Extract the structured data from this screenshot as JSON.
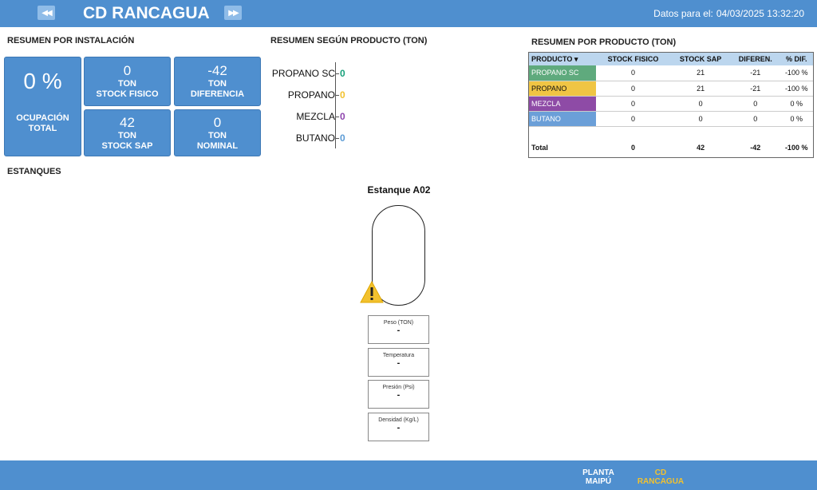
{
  "header": {
    "prev_icon": "◀◀",
    "next_icon": "▶▶",
    "title": "CD RANCAGUA",
    "timestamp_label": "Datos para el:",
    "timestamp_value": "04/03/2025 13:32:20"
  },
  "install_summary": {
    "title": "RESUMEN POR INSTALACIÓN",
    "occupancy": {
      "value": "0 %",
      "label": "OCUPACIÓN TOTAL"
    },
    "stock_fisico": {
      "value": "0",
      "unit": "TON",
      "label": "STOCK FISICO"
    },
    "diferencia": {
      "value": "-42",
      "unit": "TON",
      "label": "DIFERENCIA"
    },
    "stock_sap": {
      "value": "42",
      "unit": "TON",
      "label": "STOCK SAP"
    },
    "nominal": {
      "value": "0",
      "unit": "TON",
      "label": "NOMINAL"
    }
  },
  "product_summary": {
    "title": "RESUMEN SEGÚN PRODUCTO (TON)",
    "items": [
      {
        "name": "PROPANO SC",
        "value": "0",
        "color": "#17a07a"
      },
      {
        "name": "PROPANO",
        "value": "0",
        "color": "#f2c12e"
      },
      {
        "name": "MEZCLA",
        "value": "0",
        "color": "#8e44ad"
      },
      {
        "name": "BUTANO",
        "value": "0",
        "color": "#5b9bd5"
      }
    ]
  },
  "product_table": {
    "title": "RESUMEN POR PRODUCTO (TON)",
    "headers": [
      "PRODUCTO",
      "STOCK FISICO",
      "STOCK SAP",
      "DIFEREN.",
      "% DIF."
    ],
    "sort_icon": "▾",
    "rows": [
      {
        "product": "PROPANO SC",
        "color": "#5faa7d",
        "text_color": "#ffffff",
        "fisico": "0",
        "sap": "21",
        "dif": "-21",
        "pct": "-100 %"
      },
      {
        "product": "PROPANO",
        "color": "#f0c544",
        "text_color": "#111111",
        "fisico": "0",
        "sap": "21",
        "dif": "-21",
        "pct": "-100 %"
      },
      {
        "product": "MEZCLA",
        "color": "#8e4ba6",
        "text_color": "#ffffff",
        "fisico": "0",
        "sap": "0",
        "dif": "0",
        "pct": "0 %"
      },
      {
        "product": "BUTANO",
        "color": "#6b9fd8",
        "text_color": "#ffffff",
        "fisico": "0",
        "sap": "0",
        "dif": "0",
        "pct": "0 %"
      }
    ],
    "total": {
      "label": "Total",
      "fisico": "0",
      "sap": "42",
      "dif": "-42",
      "pct": "-100 %"
    }
  },
  "tanks": {
    "title": "ESTANQUES",
    "tank_name": "Estanque A02",
    "warning_icon": "warning-triangle-icon",
    "metrics": [
      {
        "label": "Peso (TON)",
        "value": "-"
      },
      {
        "label": "Temperatura",
        "value": "-"
      },
      {
        "label": "Presión (Psi)",
        "value": "-"
      },
      {
        "label": "Densidad (Kg/L)",
        "value": "-"
      }
    ]
  },
  "footer": {
    "links": [
      {
        "label_line1": "PLANTA",
        "label_line2": "MAIPÚ",
        "color": "#ffffff"
      },
      {
        "label_line1": "CD",
        "label_line2": "RANCAGUA",
        "color": "#f2c12e"
      }
    ]
  }
}
